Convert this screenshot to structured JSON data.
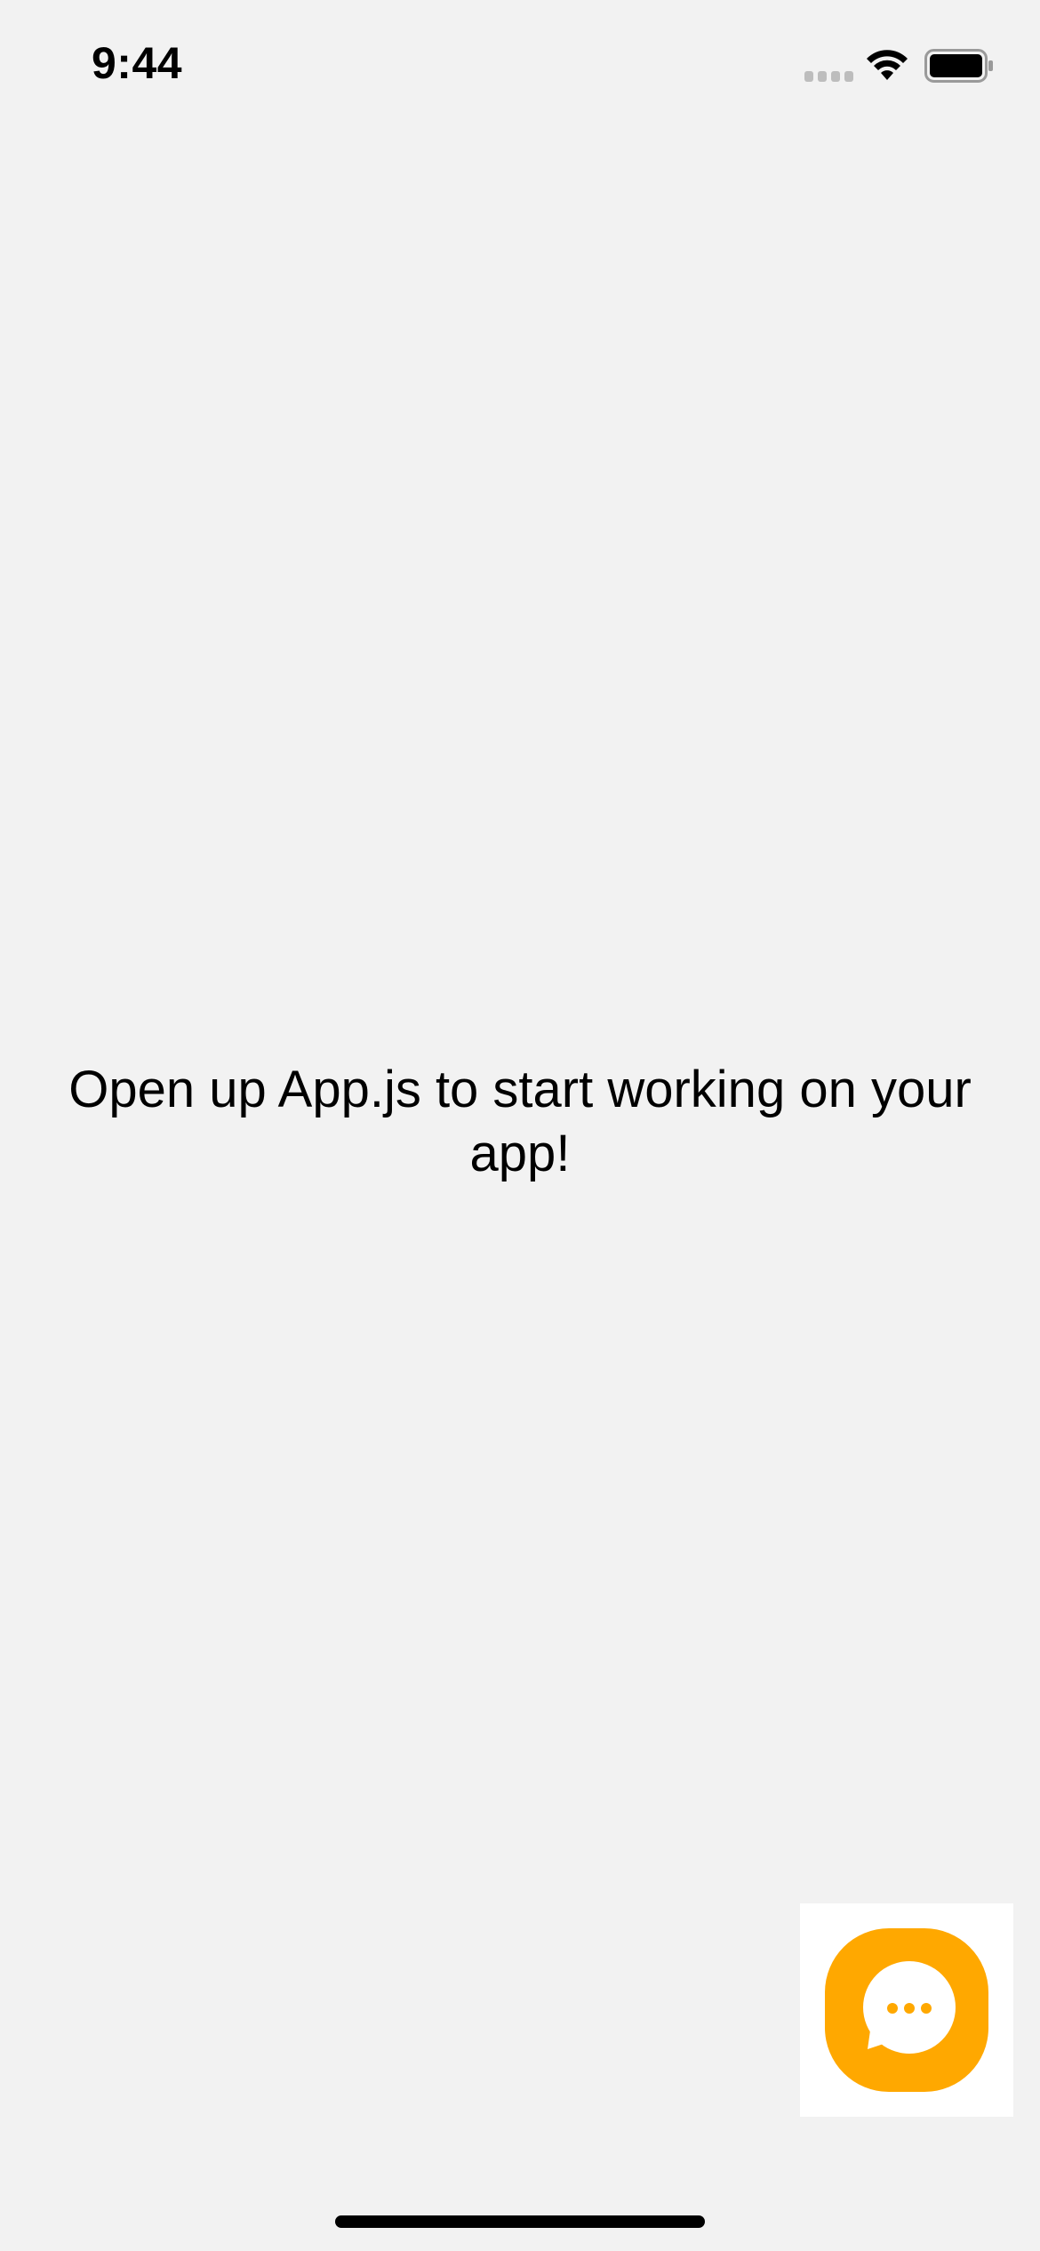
{
  "status_bar": {
    "time": "9:44",
    "signal_icon": "cellular-signal-icon",
    "wifi_icon": "wifi-icon",
    "battery_icon": "battery-icon"
  },
  "main": {
    "message": "Open up App.js to start working on your app!"
  },
  "chat_widget": {
    "icon": "chat-bubble-icon",
    "accent_color": "#ffa800"
  },
  "colors": {
    "background": "#f2f2f2",
    "text": "#000000"
  }
}
